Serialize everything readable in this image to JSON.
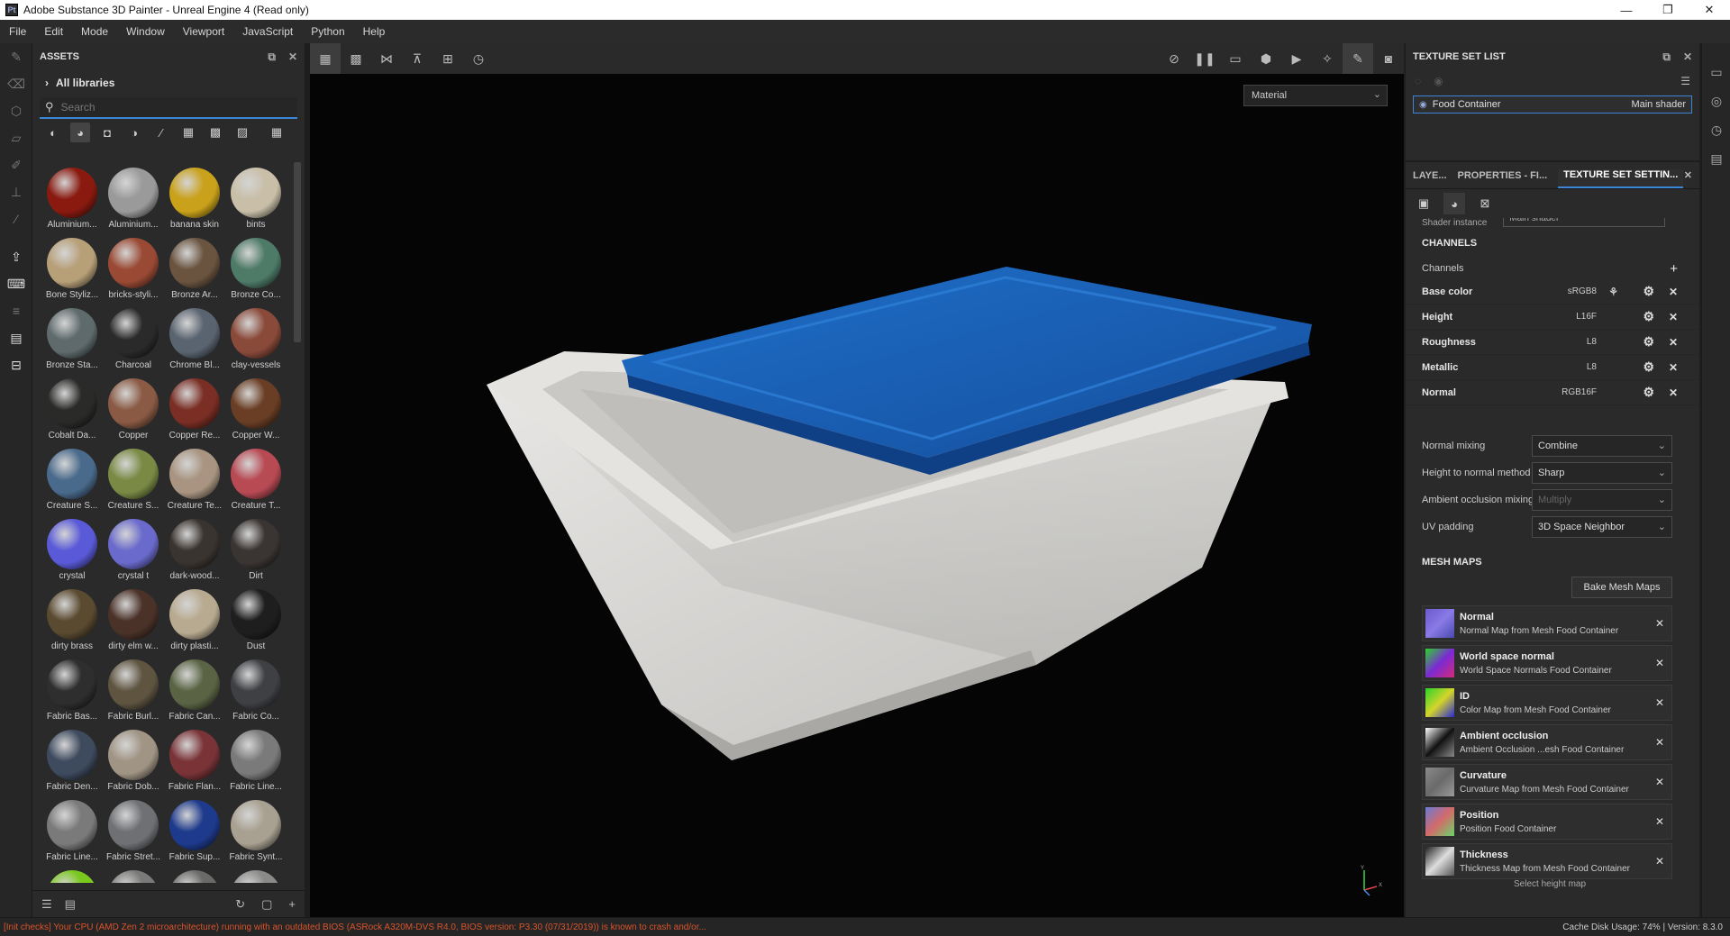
{
  "window": {
    "title": "Adobe Substance 3D Painter - Unreal Engine 4 (Read only)",
    "app_icon": "Pt",
    "min": "—",
    "max": "❐",
    "close": "✕"
  },
  "menu": [
    "File",
    "Edit",
    "Mode",
    "Window",
    "Viewport",
    "JavaScript",
    "Python",
    "Help"
  ],
  "assets": {
    "title": "ASSETS",
    "all_libraries": "All libraries",
    "search_placeholder": "Search",
    "materials": [
      {
        "label": "Aluminium...",
        "color": "#8a1a10"
      },
      {
        "label": "Aluminium...",
        "color": "#9a9a9a"
      },
      {
        "label": "banana skin",
        "color": "#c9a11a"
      },
      {
        "label": "bints",
        "color": "#c9bfa8"
      },
      {
        "label": "Bone Styliz...",
        "color": "#b79f78"
      },
      {
        "label": "bricks-styli...",
        "color": "#9a4a34"
      },
      {
        "label": "Bronze Ar...",
        "color": "#6a5440"
      },
      {
        "label": "Bronze Co...",
        "color": "#4e7a68"
      },
      {
        "label": "Bronze Sta...",
        "color": "#5e6a6c"
      },
      {
        "label": "Charcoal",
        "color": "#2a2a2a"
      },
      {
        "label": "Chrome Bl...",
        "color": "#5a6470"
      },
      {
        "label": "clay-vessels",
        "color": "#8a4a3a"
      },
      {
        "label": "Cobalt Da...",
        "color": "#2a2a28"
      },
      {
        "label": "Copper",
        "color": "#8a5a44"
      },
      {
        "label": "Copper Re...",
        "color": "#7a2e24"
      },
      {
        "label": "Copper W...",
        "color": "#6a3e24"
      },
      {
        "label": "Creature S...",
        "color": "#4a6a8c"
      },
      {
        "label": "Creature S...",
        "color": "#7a8a44"
      },
      {
        "label": "Creature Te...",
        "color": "#a89480"
      },
      {
        "label": "Creature T...",
        "color": "#b84a54"
      },
      {
        "label": "crystal",
        "color": "#5a5ad8"
      },
      {
        "label": "crystal t",
        "color": "#6a6acc"
      },
      {
        "label": "dark-wood...",
        "color": "#3a3430"
      },
      {
        "label": "Dirt",
        "color": "#3a3432"
      },
      {
        "label": "dirty brass",
        "color": "#5a4a30"
      },
      {
        "label": "dirty elm w...",
        "color": "#4a3228"
      },
      {
        "label": "dirty plasti...",
        "color": "#b8aa90"
      },
      {
        "label": "Dust",
        "color": "#1e1e1e"
      },
      {
        "label": "Fabric Bas...",
        "color": "#2e2e2e"
      },
      {
        "label": "Fabric Burl...",
        "color": "#5e5440"
      },
      {
        "label": "Fabric Can...",
        "color": "#5a6444"
      },
      {
        "label": "Fabric Co...",
        "color": "#3e4044"
      },
      {
        "label": "Fabric Den...",
        "color": "#3e4a5e"
      },
      {
        "label": "Fabric Dob...",
        "color": "#a09484"
      },
      {
        "label": "Fabric Flan...",
        "color": "#7a3438"
      },
      {
        "label": "Fabric Line...",
        "color": "#7a7a7a"
      },
      {
        "label": "Fabric Line...",
        "color": "#7a7a7a"
      },
      {
        "label": "Fabric Stret...",
        "color": "#6e7074"
      },
      {
        "label": "Fabric Sup...",
        "color": "#1e3a8c"
      },
      {
        "label": "Fabric Synt...",
        "color": "#a8a090"
      },
      {
        "label": "",
        "color": "#7ac81e"
      },
      {
        "label": "",
        "color": "#7a7a78"
      },
      {
        "label": "",
        "color": "#6a6a68"
      },
      {
        "label": "",
        "color": "#8a8a88"
      }
    ]
  },
  "viewport": {
    "material_select": "Material",
    "axis_y": "Y",
    "axis_x": "X"
  },
  "texture_set_list": {
    "title": "TEXTURE SET LIST",
    "entry_name": "Food Container",
    "entry_shader": "Main shader"
  },
  "tabs": {
    "layers": "LAYE...",
    "properties": "PROPERTIES - FI...",
    "tss": "TEXTURE SET SETTIN..."
  },
  "tss": {
    "shader_instance_label": "Shader instance",
    "shader_instance_value": "Main shader",
    "channels_title": "CHANNELS",
    "channels_label": "Channels",
    "channels": [
      {
        "name": "Base color",
        "format": "sRGB8"
      },
      {
        "name": "Height",
        "format": "L16F"
      },
      {
        "name": "Roughness",
        "format": "L8"
      },
      {
        "name": "Metallic",
        "format": "L8"
      },
      {
        "name": "Normal",
        "format": "RGB16F"
      }
    ],
    "normal_mixing_label": "Normal mixing",
    "normal_mixing_value": "Combine",
    "height_to_normal_label": "Height to normal method",
    "height_to_normal_value": "Sharp",
    "ao_mixing_label": "Ambient occlusion mixing",
    "ao_mixing_value": "Multiply",
    "uv_padding_label": "UV padding",
    "uv_padding_value": "3D Space Neighbor",
    "mesh_maps_title": "MESH MAPS",
    "bake_button": "Bake Mesh Maps",
    "mesh_maps": [
      {
        "name": "Normal",
        "desc": "Normal Map from Mesh Food Container"
      },
      {
        "name": "World space normal",
        "desc": "World Space Normals Food Container"
      },
      {
        "name": "ID",
        "desc": "Color Map from Mesh Food Container"
      },
      {
        "name": "Ambient occlusion",
        "desc": "Ambient Occlusion ...esh Food Container"
      },
      {
        "name": "Curvature",
        "desc": "Curvature Map from Mesh Food Container"
      },
      {
        "name": "Position",
        "desc": "Position Food Container"
      },
      {
        "name": "Thickness",
        "desc": "Thickness Map from Mesh Food Container"
      }
    ],
    "cutoff_row": "Select height map"
  },
  "status": {
    "message": "[Init checks] Your CPU (AMD Zen 2 microarchitecture) running with an outdated BIOS (ASRock A320M-DVS R4.0, BIOS version: P3.30 (07/31/2019)) is known to crash and/or...",
    "disk_usage": "Cache Disk Usage:  74%  |  Version: 8.3.0"
  }
}
